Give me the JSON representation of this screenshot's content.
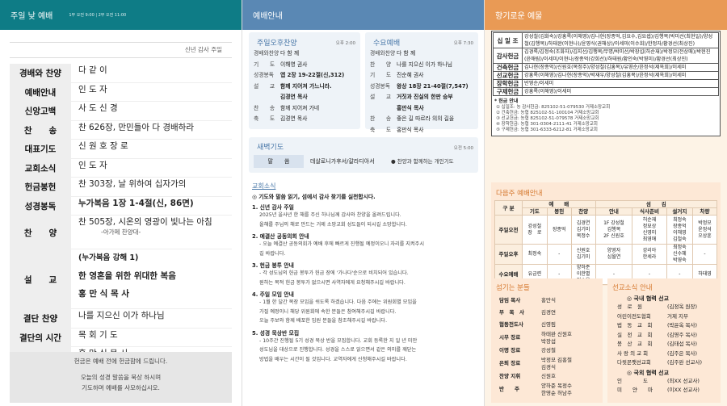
{
  "col1": {
    "header": "주일 낮 예배",
    "header_sub": "1부 오전 9:00 | 2부 오전 11:00",
    "subtitle": "신년 감사 주일",
    "order": [
      {
        "label": "경배와 찬양",
        "value": "다 같 이",
        "bold": false
      },
      {
        "label": "예배안내",
        "value": "인 도 자",
        "bold": false
      },
      {
        "label": "신앙고백",
        "value": "사 도 신 경",
        "bold": false
      },
      {
        "label": "찬　　송",
        "value": "찬 626장, 만민들아 다 경배하라",
        "bold": false
      },
      {
        "label": "대표기도",
        "value": "신 원 호 장 로",
        "bold": false
      },
      {
        "label": "교회소식",
        "value": "인 도 자",
        "bold": false
      },
      {
        "label": "헌금봉헌",
        "value": "찬 303장, 날 위하여 십자가의",
        "bold": false
      },
      {
        "label": "성경봉독",
        "value": "누가복음 1장 1-4절(신, 86면)",
        "bold": true
      }
    ],
    "chanyang_label": "찬　　양",
    "chanyang_value": "찬 505장, 시온의 영광이 빛나는 아침",
    "chanyang_sub": "-아가페 찬양대-",
    "sermon_label": "설　　교",
    "sermon_ref": "(누가복음 강해 1)",
    "sermon_title": "한 영혼을 위한 위대한 복음",
    "sermon_preacher": "홍 만 식 목 사",
    "order2": [
      {
        "label": "결단 찬양",
        "value": "나를 지으신 이가 하나님"
      },
      {
        "label": "결단의 시간",
        "value": "목 회 기 도"
      },
      {
        "label": "축　　도",
        "value": "홍 만 식 목 사"
      }
    ],
    "notice1": "헌금은 예배 전에 헌금함에 드립니다.",
    "notice2": "오늘의 성경 말씀을 묵상 하시며",
    "notice3": "기도하며 예배를 사모하십시오."
  },
  "col2": {
    "header": "예배안내",
    "pm": {
      "title": "주일오후찬양",
      "time": "오후 2:00",
      "rows": [
        {
          "k": "경배와찬양",
          "v": "다 함 께",
          "b": false
        },
        {
          "k": "기　　도",
          "v": "이해영 권사",
          "b": false
        },
        {
          "k": "성경봉독",
          "v": "엡 2장 19-22절(신,312)",
          "b": true
        },
        {
          "k": "설　　교",
          "v": "함께 지어져 가느니라.",
          "b": true
        },
        {
          "k": "",
          "v": "김경연 목사",
          "b": true
        },
        {
          "k": "찬　　송",
          "v": "함께 지어져 가네",
          "b": false
        },
        {
          "k": "축　　도",
          "v": "김경연 목사",
          "b": false
        }
      ]
    },
    "wed": {
      "title": "수요예배",
      "time": "오후 7:30",
      "rows": [
        {
          "k": "경배와찬양",
          "v": "다 함 께",
          "b": false
        },
        {
          "k": "찬　　양",
          "v": "나를 지으신 이가 하나님",
          "b": false
        },
        {
          "k": "기　　도",
          "v": "진순혜 권사",
          "b": false
        },
        {
          "k": "성경봉독",
          "v": "왕상 18장 21-40절(7,547)",
          "b": true
        },
        {
          "k": "설　　교",
          "v": "거짓과 진실의 한판 승부",
          "b": true
        },
        {
          "k": "",
          "v": "홍만식 목사",
          "b": true
        },
        {
          "k": "찬　　송",
          "v": "좋은 길 따르라 의의 길을",
          "b": false
        },
        {
          "k": "축　　도",
          "v": "홍만식 목사",
          "b": false
        }
      ]
    },
    "dawn": {
      "title": "새벽기도",
      "time": "오전 5:00",
      "label": "말　　씀",
      "value": "데살로니가후서/갈라디아서",
      "note": "● 찬양과 함께하는 개인기도"
    },
    "news": {
      "title": "교회소식",
      "intro": "◎ 기도와 말씀 읽기, 섬에서 감사 찾기를 실천합시다.",
      "items": [
        {
          "h": "1. 신년 감사 주일",
          "lines": [
            "2025년 을사년 한 해를 주신 하나님께 감사와 찬양을 올려드립니다.",
            "올해를 주님의 해로 만드는 거제 소망교회 성도들이 되시길 소망합니다."
          ]
        },
        {
          "h": "2. 예결산 공동의회 안내",
          "lines": [
            "- 오늘 예결산 공동의회가 예배 후에 빠르게 진행될 예정이오니 자리를 지켜주시",
            "길 바랍니다."
          ]
        },
        {
          "h": "3. 헌금 봉투 안내",
          "lines": [
            "- 각 성도님의 헌금 봉투가 헌금 장에 '가나다'순으로 비치되어 있습니다.",
            "원하는 목적 헌금 봉투가 없으시면 사역자에게 요청해주시길 바랍니다."
          ]
        },
        {
          "h": "4. 주일 모임 안내",
          "lines": [
            "- 1월 한 달간 목장 모임을 쉬도록 하겠습니다. 다음 주에는 위원회별 모임을",
            "가질 예정이니 해당 위원회에 속한 분들은 참여해주시길 바랍니다.",
            "오늘 주보와 함께 배포한 임원 분들을 참조해주시길 바랍니다."
          ]
        },
        {
          "h": "5. 성경 묵상반 모집",
          "lines": [
            "- 10주간 진행될 5기 성경 묵상 반을 모집합니다. 교회 등록한 지 일 년 미만",
            "성도님을 대상으로 진행합니다. 성경을 스스로 읽으면서 같은 의미를 깨닫는",
            "방법을 배우는 시간이 될 것입니다. 교역자에게 신청해주시길 바랍니다."
          ]
        }
      ]
    }
  },
  "col3": {
    "header": "향기로운 예물",
    "offerings": [
      {
        "k": "십 일 조",
        "v": "강성철(김화숙)/강홍록(이해영)/김나현(장종억,김요수,김요셉)/김행복(박미선(최현일)/양성철(김행복)/하태완(이현나)/윤영식(권해상)/이세미(이수희)/한정자/황경선(최상진)"
      },
      {
        "k": "감사헌금",
        "v": "김경록/김정숙(조화자)/김지선/김행복/무명/박미선/박장섭(하순재)/박정모(전상매)/박현진(윤애림)/이세미/이현나/장종억(강희선)/하태원/황인숙(박영미)/황경선(최상진)"
      },
      {
        "k": "건축헌금",
        "v": "김나현(장종억)/신원호(목정주)/양성철(김홍복)/유영순/윤정석(제옥희)/이세미"
      },
      {
        "k": "선교헌금",
        "v": "강홍록(이해영)/김나현(장종억)/박재우/양성철(김홍복)/윤정석(제옥희)/이세미"
      },
      {
        "k": "장학헌금",
        "v": "반영순/이세미"
      },
      {
        "k": "구제헌금",
        "v": "강홍록(이해영)/이세미"
      }
    ],
    "account_title": "* 헌금 안내",
    "accounts": [
      "① 십일조: 농 감사헌금: 825102-51-079530 거제소망교회",
      "② 건축헌금: 농협 825102-51-100104 거제소망교회",
      "③ 선교헌금: 농협 825102-51-079578 거제소망교회",
      "④ 장학헌금: 농협 301-0304-2111-41 거제소망교회",
      "⑤ 구제헌금: 농협 301-6333-6212-81 거제소망교회"
    ],
    "next": {
      "title": "다음주 예배안내",
      "top_headers": [
        "구 분",
        "예　　배",
        "섬　　김"
      ],
      "sub_headers": [
        "기도",
        "봉헌",
        "찬양",
        "안내",
        "식사준비",
        "설거지",
        "차량"
      ],
      "rows": [
        {
          "k": "주일오전",
          "cells": [
            "강성철\n장　로",
            "장종억",
            "김경연\n김기미\n목정수",
            "1F 강성철\n김행복\n2F 신원호",
            "허순재\n정묘상\n신영미\n최영애",
            "최정숙\n장종억\n이해영\n김철숙",
            "박정모\n윤정석\n오상훈"
          ]
        },
        {
          "k": "주일오후",
          "cells": [
            "최정숙",
            "-",
            "신원호\n김기미",
            "양영자\n심월연",
            "강리아\n한세라",
            "최정숙\n신수혜\n박영숙",
            "-"
          ]
        },
        {
          "k": "수요예배",
          "cells": [
            "유금련",
            "-",
            "양하준\n이한별\n정소윤",
            "-",
            "-",
            "-",
            "하태영"
          ]
        }
      ]
    },
    "servants": {
      "title": "섬기는 분들",
      "rows": [
        {
          "k": "담임 목사",
          "v": "홍만식"
        },
        {
          "k": "부　목　사",
          "v": "김경연"
        },
        {
          "k": "협동전도사",
          "v": "신영림"
        },
        {
          "k": "시무 장로",
          "v": "하태완 신원호\n박장섭"
        },
        {
          "k": "이명 장로",
          "v": "강성철"
        },
        {
          "k": "은퇴 장로",
          "v": "박정모 김홍철\n김경식"
        },
        {
          "k": "찬양 지휘",
          "v": "신원호"
        },
        {
          "k": "반　　주",
          "v": "양하준 목정수\n한영순 허남주"
        }
      ]
    },
    "missions": {
      "title": "선교소식 안내",
      "domestic_title": "◎ 국내 협력 선교",
      "domestic": [
        {
          "k": "성　로　원",
          "v": "(김정옥 원장)"
        },
        {
          "k": "어린이전도협회",
          "v": "거제 지부"
        },
        {
          "k": "법　동　교　회",
          "v": "(박윤옥 목사)"
        },
        {
          "k": "실　전　교　회",
          "v": "(김영주 목사)"
        },
        {
          "k": "봉　산　교　회",
          "v": "(김태섭 목사)"
        },
        {
          "k": "사 랑 의 교 회",
          "v": "(김주은 목사)"
        },
        {
          "k": "다윗몬팻선교회",
          "v": "(김주완 선교사)"
        }
      ],
      "foreign_title": "◎ 국외 협력 선교",
      "foreign": [
        {
          "k": "인　　　　도",
          "v": "(최XX 선교사)"
        },
        {
          "k": "미　　얀　　마",
          "v": "(이XX 선교사)"
        }
      ]
    }
  }
}
